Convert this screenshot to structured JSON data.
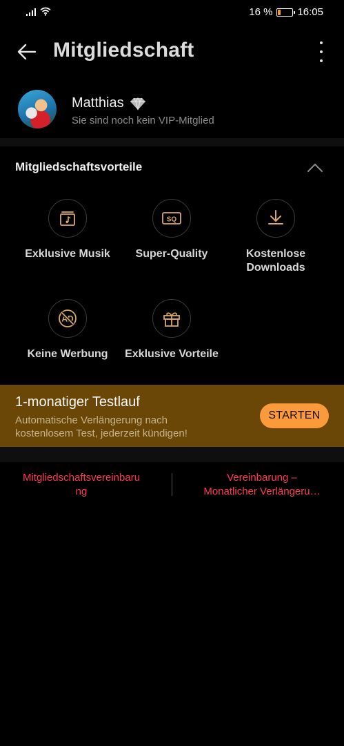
{
  "status_bar": {
    "battery_text": "16 %",
    "battery_level": 0.16,
    "time": "16:05",
    "battery_color": "#ff9a1f"
  },
  "header": {
    "title": "Mitgliedschaft",
    "back_icon": "arrow-left-icon",
    "more_icon": "more-vertical-icon"
  },
  "profile": {
    "name": "Matthias",
    "badge_icon": "diamond-icon",
    "subtitle": "Sie sind noch kein VIP-Mitglied"
  },
  "benefits": {
    "heading": "Mitgliedschaftsvorteile",
    "collapse_icon": "chevron-up-icon",
    "items": [
      {
        "label": "Exklusive Musik",
        "icon": "music-note-card-icon"
      },
      {
        "label": "Super-Quality",
        "icon": "sq-badge-icon"
      },
      {
        "label_line1": "Kostenlose",
        "label_line2": "Downloads",
        "icon": "download-icon"
      },
      {
        "label": "Keine Werbung",
        "icon": "no-ads-icon"
      },
      {
        "label": "Exklusive Vorteile",
        "icon": "gift-icon"
      }
    ],
    "icon_color": "#d9a864"
  },
  "trial": {
    "title": "1-monatiger Testlauf",
    "subtitle_line1": "Automatische Verlängerung nach",
    "subtitle_line2": "kostenlosem Test, jederzeit kündigen!",
    "button": "STARTEN",
    "banner_color": "#6a4706",
    "button_color": "#fb9a3a"
  },
  "links": {
    "left_line1": "Mitgliedschaftsvereinbaru",
    "left_line2": "ng",
    "right_line1": "Vereinbarung –",
    "right_line2": "Monatlicher Verlängeru…",
    "color": "#ff3a54"
  }
}
